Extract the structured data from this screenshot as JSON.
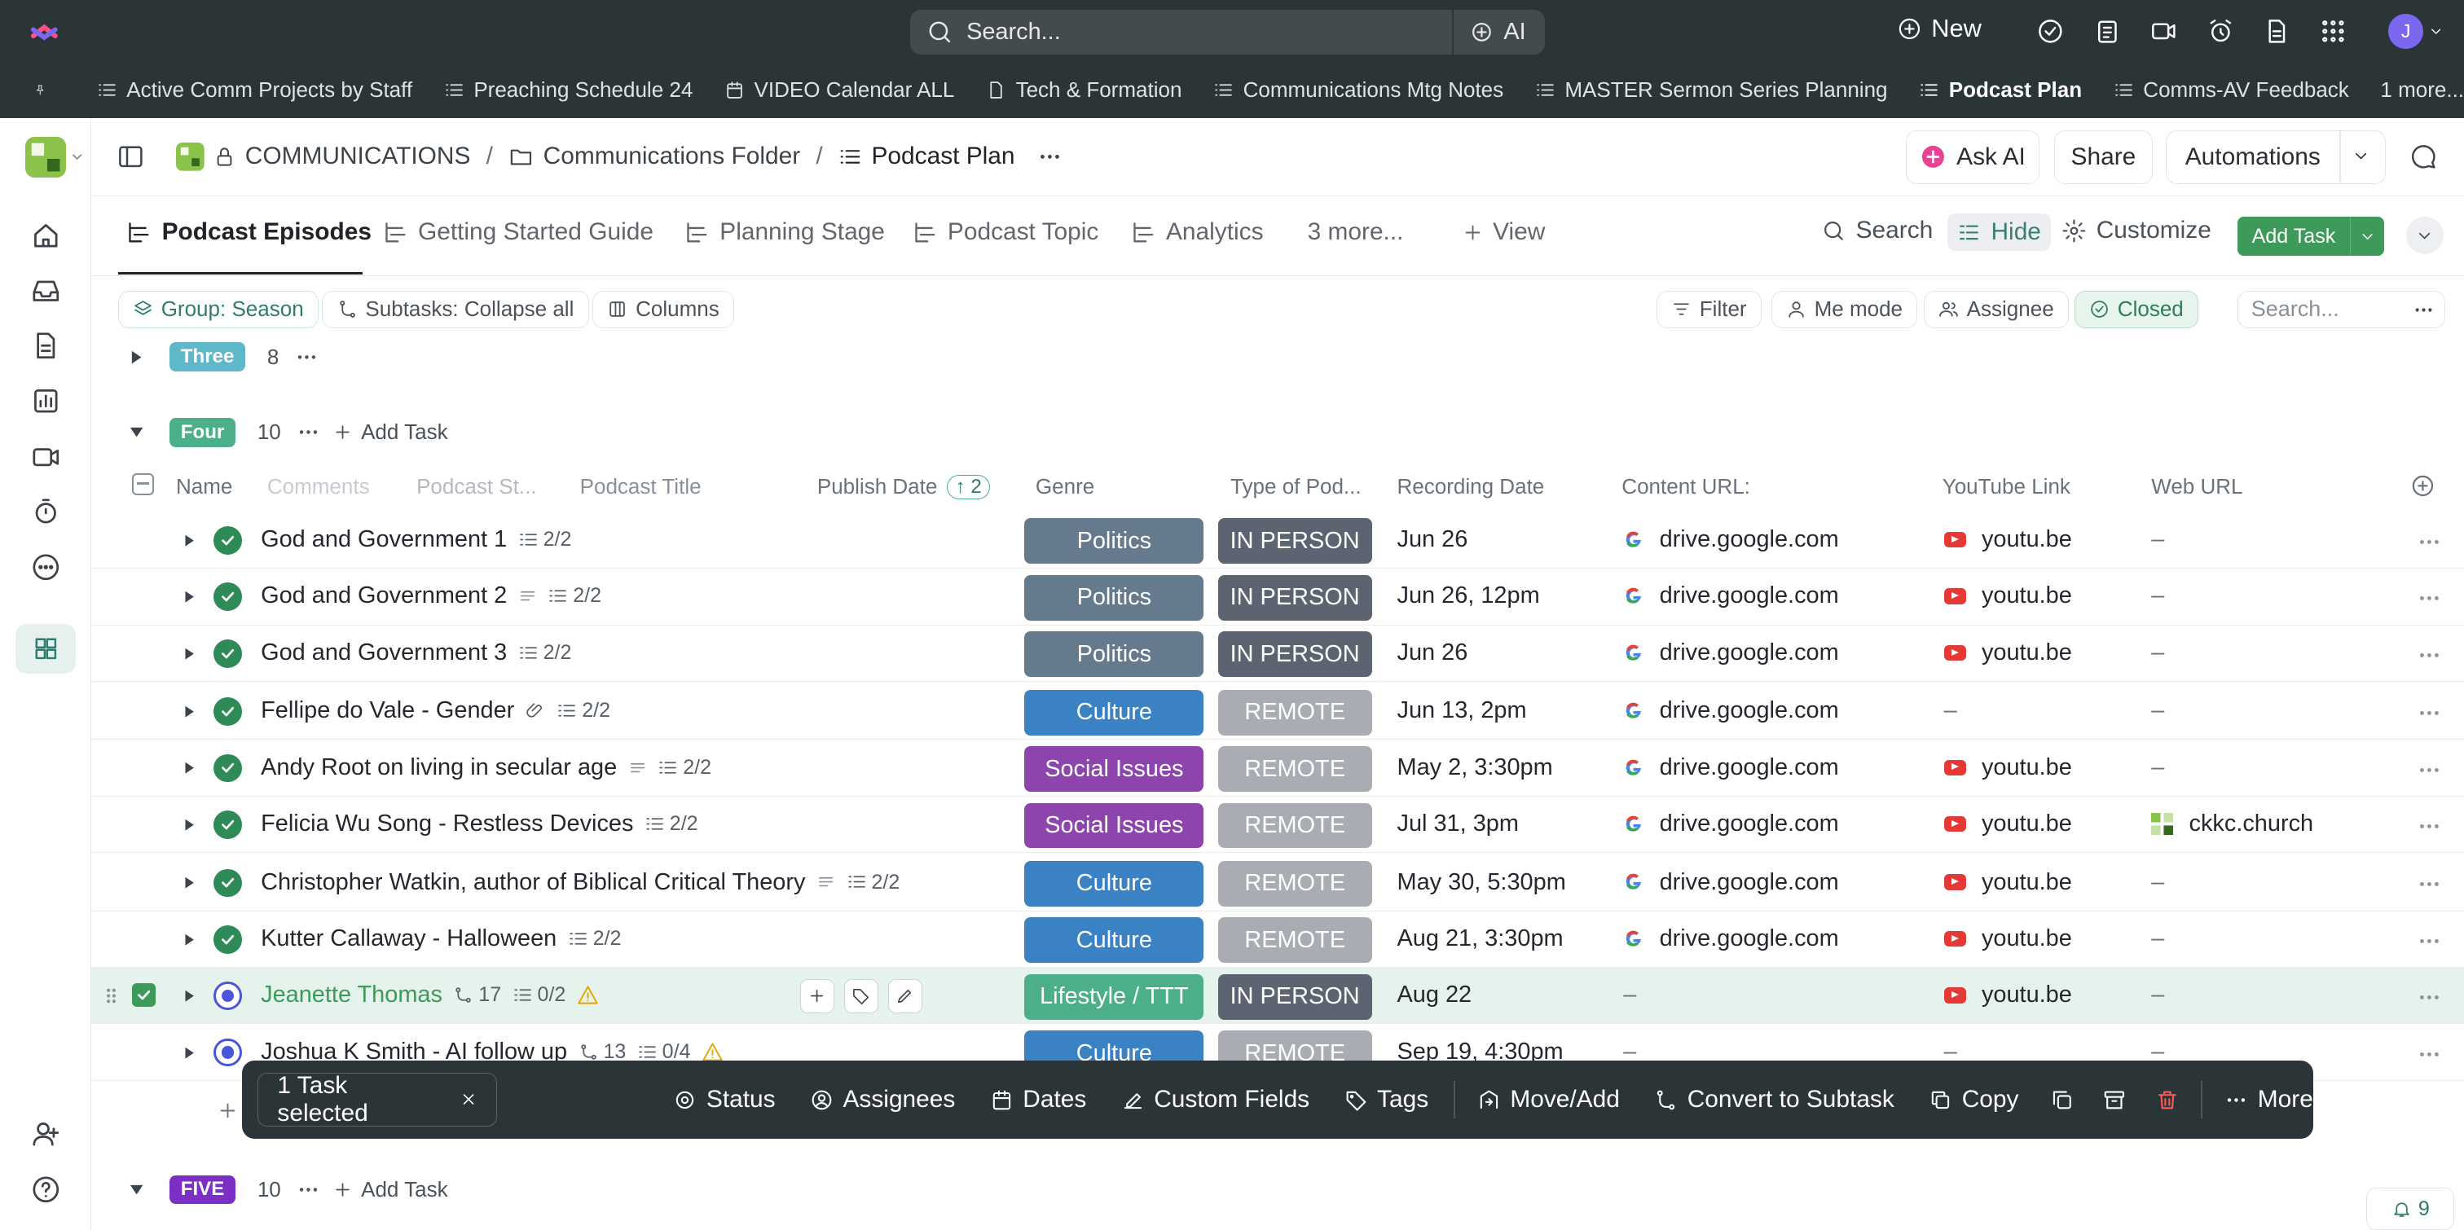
{
  "topbar": {
    "search_placeholder": "Search...",
    "ai_label": "AI",
    "new_label": "New",
    "avatar_initial": "J"
  },
  "favorites": [
    {
      "label": "Active Comm Projects by Staff",
      "icon": "list-icon"
    },
    {
      "label": "Preaching Schedule 24",
      "icon": "list-icon"
    },
    {
      "label": "VIDEO Calendar ALL",
      "icon": "calendar-icon"
    },
    {
      "label": "Tech & Formation",
      "icon": "doc-icon"
    },
    {
      "label": "Communications Mtg Notes",
      "icon": "list-icon"
    },
    {
      "label": "MASTER Sermon Series Planning",
      "icon": "list-icon"
    },
    {
      "label": "Podcast Plan",
      "icon": "list-icon",
      "active": true
    },
    {
      "label": "Comms-AV Feedback",
      "icon": "list-icon"
    },
    {
      "label": "1 more...",
      "icon": ""
    }
  ],
  "breadcrumb": {
    "space": "COMMUNICATIONS",
    "folder": "Communications Folder",
    "list": "Podcast Plan"
  },
  "header_buttons": {
    "ask_ai": "Ask AI",
    "share": "Share",
    "automations": "Automations"
  },
  "tabs": [
    {
      "label": "Podcast Episodes",
      "active": true
    },
    {
      "label": "Getting Started Guide"
    },
    {
      "label": "Planning Stage"
    },
    {
      "label": "Podcast Topic"
    },
    {
      "label": "Analytics"
    },
    {
      "label": "3 more..."
    },
    {
      "label": "View"
    }
  ],
  "tab_actions": {
    "search": "Search",
    "hide": "Hide",
    "customize": "Customize",
    "add_task": "Add Task"
  },
  "filters": {
    "group": "Group: Season",
    "subtasks": "Subtasks: Collapse all",
    "columns": "Columns",
    "filter": "Filter",
    "me_mode": "Me mode",
    "assignee": "Assignee",
    "closed": "Closed",
    "search_placeholder": "Search..."
  },
  "groups": {
    "three": {
      "label": "Three",
      "count": "8",
      "color": "#5fb8c9"
    },
    "four": {
      "label": "Four",
      "count": "10",
      "color": "#4caf8a",
      "add_task": "Add Task"
    },
    "five": {
      "label": "FIVE",
      "count": "10",
      "color": "#7b2fc4",
      "add_task": "Add Task"
    }
  },
  "columns": {
    "name": "Name",
    "comments": "Comments",
    "podcast_status": "Podcast St...",
    "podcast_title": "Podcast Title",
    "publish_date": "Publish Date",
    "publish_sort": "2",
    "genre": "Genre",
    "type": "Type of Pod...",
    "recording_date": "Recording Date",
    "content_url": "Content URL:",
    "youtube": "YouTube Link",
    "web_url": "Web URL"
  },
  "tasks": [
    {
      "name": "God and Government 1",
      "subtasks": "2/2",
      "genre": "Politics",
      "genre_color": "#657a8c",
      "type": "IN PERSON",
      "type_color": "#5b6470",
      "recording": "Jun 26",
      "content": "drive.google.com",
      "youtube": "youtu.be",
      "web": "–"
    },
    {
      "name": "God and Government 2",
      "subtasks": "2/2",
      "genre": "Politics",
      "genre_color": "#657a8c",
      "type": "IN PERSON",
      "type_color": "#5b6470",
      "recording": "Jun 26, 12pm",
      "content": "drive.google.com",
      "youtube": "youtu.be",
      "web": "–"
    },
    {
      "name": "God and Government 3",
      "subtasks": "2/2",
      "genre": "Politics",
      "genre_color": "#657a8c",
      "type": "IN PERSON",
      "type_color": "#5b6470",
      "recording": "Jun 26",
      "content": "drive.google.com",
      "youtube": "youtu.be",
      "web": "–"
    },
    {
      "name": "Fellipe do Vale - Gender",
      "subtasks": "2/2",
      "genre": "Culture",
      "genre_color": "#3b82c4",
      "type": "REMOTE",
      "type_color": "#a9adb3",
      "recording": "Jun 13, 2pm",
      "content": "drive.google.com",
      "youtube": "–",
      "web": "–"
    },
    {
      "name": "Andy Root on living in secular age",
      "subtasks": "2/2",
      "genre": "Social Issues",
      "genre_color": "#8e44ad",
      "type": "REMOTE",
      "type_color": "#a9adb3",
      "recording": "May 2, 3:30pm",
      "content": "drive.google.com",
      "youtube": "youtu.be",
      "web": "–"
    },
    {
      "name": "Felicia Wu Song - Restless Devices",
      "subtasks": "2/2",
      "genre": "Social Issues",
      "genre_color": "#8e44ad",
      "type": "REMOTE",
      "type_color": "#a9adb3",
      "recording": "Jul 31, 3pm",
      "content": "drive.google.com",
      "youtube": "youtu.be",
      "web": "ckkc.church"
    },
    {
      "name": "Christopher Watkin, author of Biblical Critical Theory",
      "subtasks": "2/2",
      "genre": "Culture",
      "genre_color": "#3b82c4",
      "type": "REMOTE",
      "type_color": "#a9adb3",
      "recording": "May 30, 5:30pm",
      "content": "drive.google.com",
      "youtube": "youtu.be",
      "web": "–"
    },
    {
      "name": "Kutter Callaway - Halloween",
      "subtasks": "2/2",
      "genre": "Culture",
      "genre_color": "#3b82c4",
      "type": "REMOTE",
      "type_color": "#a9adb3",
      "recording": "Aug 21, 3:30pm",
      "content": "drive.google.com",
      "youtube": "youtu.be",
      "web": "–"
    },
    {
      "name": "Jeanette Thomas",
      "deps": "17",
      "subtasks": "0/2",
      "genre": "Lifestyle / TTT",
      "genre_color": "#4caf8a",
      "type": "IN PERSON",
      "type_color": "#5b6470",
      "recording": "Aug 22",
      "content": "–",
      "youtube": "youtu.be",
      "web": "–"
    },
    {
      "name": "Joshua K Smith - AI follow up",
      "deps": "13",
      "subtasks": "0/4",
      "genre": "Culture",
      "genre_color": "#3b82c4",
      "type": "REMOTE",
      "type_color": "#a9adb3",
      "recording": "Sep 19, 4:30pm",
      "content": "–",
      "youtube": "–",
      "web": "–"
    }
  ],
  "action_bar": {
    "selected": "1 Task selected",
    "status": "Status",
    "assignees": "Assignees",
    "dates": "Dates",
    "custom_fields": "Custom Fields",
    "tags": "Tags",
    "move_add": "Move/Add",
    "convert": "Convert to Subtask",
    "copy": "Copy",
    "more": "More"
  },
  "footer_badge": "9"
}
